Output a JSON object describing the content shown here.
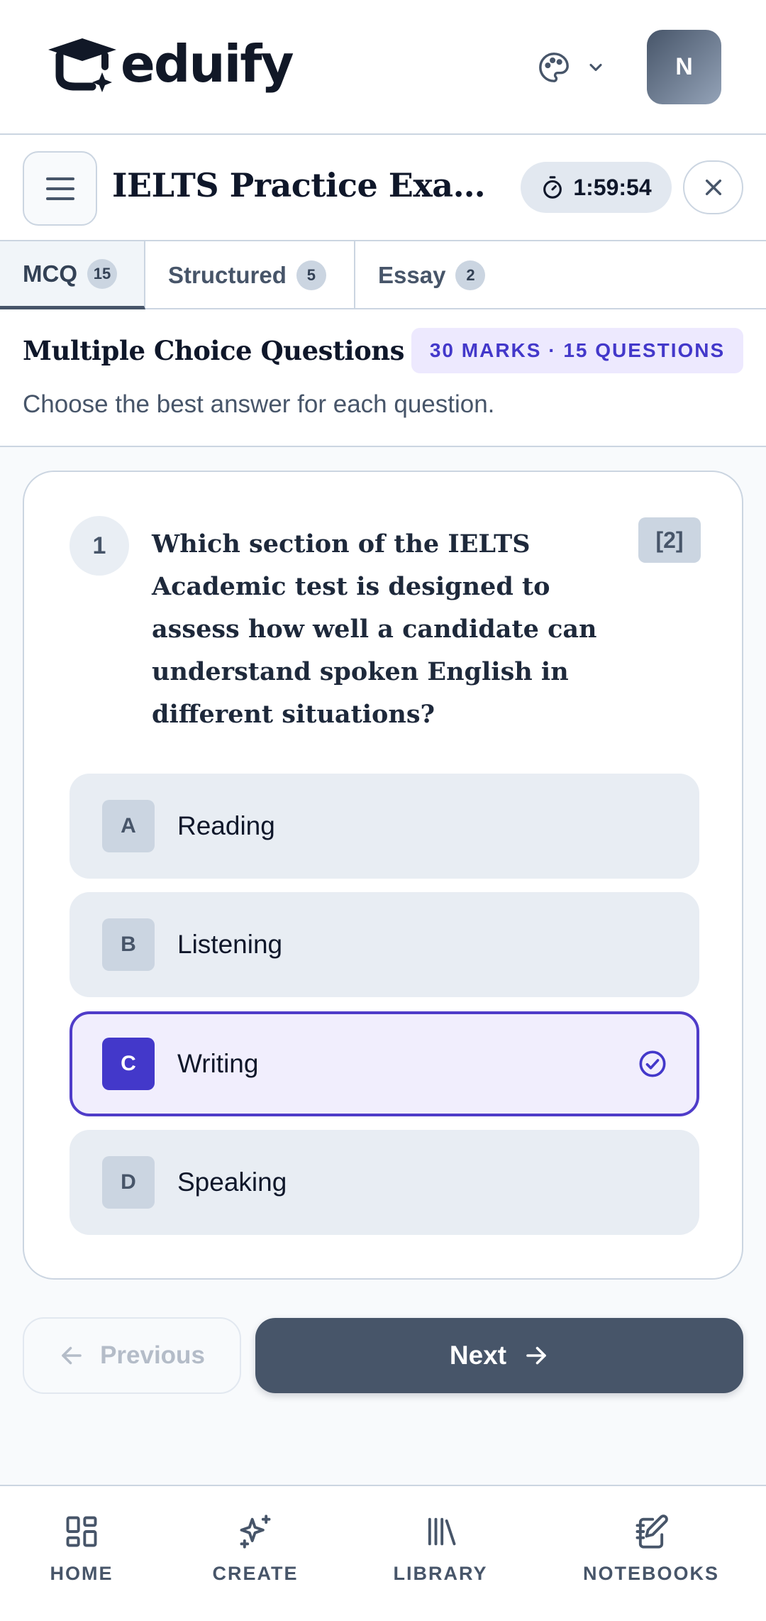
{
  "app": {
    "logo_text": "eduify",
    "avatar_initial": "N"
  },
  "exam": {
    "title": "IELTS Practice Examination",
    "timer": "1:59:54"
  },
  "tabs": [
    {
      "label": "MCQ",
      "count": "15",
      "active": true
    },
    {
      "label": "Structured",
      "count": "5",
      "active": false
    },
    {
      "label": "Essay",
      "count": "2",
      "active": false
    }
  ],
  "section": {
    "title": "Multiple Choice Questions",
    "badge": "30 MARKS · 15 QUESTIONS",
    "subtitle": "Choose the best answer for each question."
  },
  "question": {
    "number": "1",
    "text": "Which section of the IELTS Academic test is designed to assess how well a candidate can understand spoken English in different situations?",
    "marks": "[2]",
    "options": [
      {
        "letter": "A",
        "text": "Reading",
        "selected": false
      },
      {
        "letter": "B",
        "text": "Listening",
        "selected": false
      },
      {
        "letter": "C",
        "text": "Writing",
        "selected": true
      },
      {
        "letter": "D",
        "text": "Speaking",
        "selected": false
      }
    ]
  },
  "navigation": {
    "previous_label": "Previous",
    "next_label": "Next"
  },
  "bottom_nav": [
    {
      "label": "HOME",
      "icon": "grid-icon"
    },
    {
      "label": "CREATE",
      "icon": "sparkles-icon"
    },
    {
      "label": "LIBRARY",
      "icon": "library-icon"
    },
    {
      "label": "NOTEBOOKS",
      "icon": "notebook-edit-icon"
    }
  ],
  "colors": {
    "accent": "#4338ca",
    "selected_bg": "#f1eefd",
    "primary_button": "#475569"
  }
}
